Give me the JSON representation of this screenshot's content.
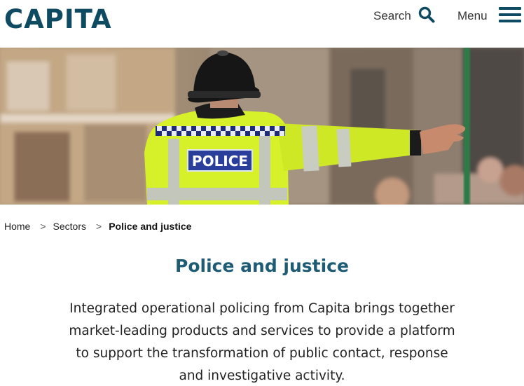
{
  "header": {
    "logo_text": "CAPITA",
    "search_label": "Search",
    "menu_label": "Menu"
  },
  "hero": {
    "image_subject": "police-officer-directing-traffic",
    "badge_text": "POLICE",
    "colors": {
      "hi_vis": "#d6f02a",
      "badge_bg": "#2a3f9c",
      "brand": "#0e4a62"
    }
  },
  "breadcrumb": {
    "items": [
      {
        "label": "Home"
      },
      {
        "label": "Sectors"
      },
      {
        "label": "Police and justice"
      }
    ],
    "separator": ">"
  },
  "main": {
    "title": "Police and justice",
    "intro": "Integrated operational policing from Capita brings together market-leading products and services to provide a platform to support the transformation of public contact, response and investigative activity."
  }
}
